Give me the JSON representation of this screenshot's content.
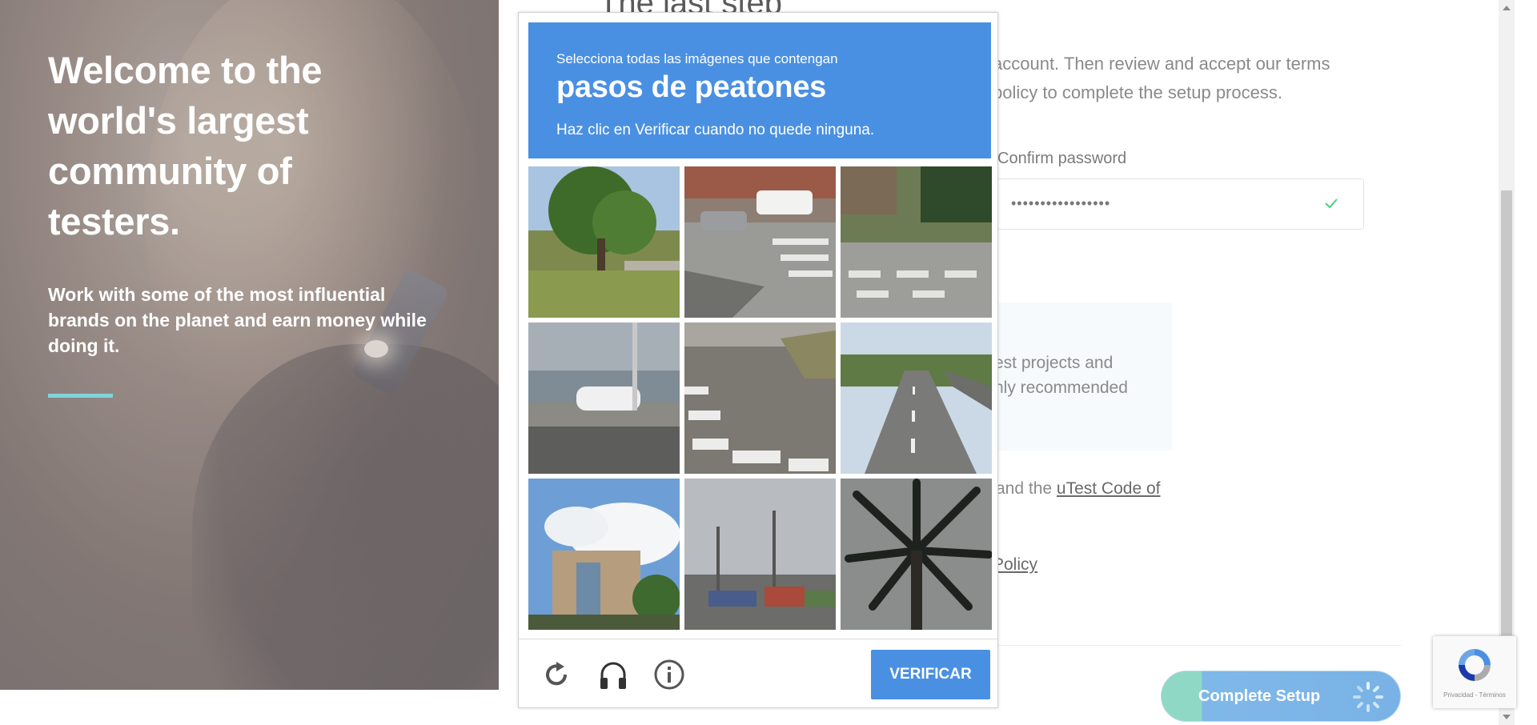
{
  "hero": {
    "title": "Welcome to the world's largest community of testers.",
    "subtitle": "Work with some of the most influential brands on the planet and earn money while doing it."
  },
  "form": {
    "heading": "The last step",
    "intro": "account. Then review and accept our terms policy to complete the setup process.",
    "confirm_password_label": "Confirm password",
    "confirm_password_value": "•••••••••••••••••",
    "info_line1": "est projects and",
    "info_line2": "hly recommended",
    "info_line3": ".",
    "terms_text": "and the ",
    "terms_link": "uTest Code of",
    "policy_link": "Policy",
    "complete_button": "Complete Setup"
  },
  "captcha": {
    "instruction_line1": "Selecciona todas las imágenes que contengan",
    "target_object": "pasos de peatones",
    "instruction_line3": "Haz clic en Verificar cuando no quede ninguna.",
    "verify_button": "VERIFICAR",
    "tiles": [
      "tree-park-image",
      "street-crosswalk-truck-image",
      "street-crosswalk-corner-image",
      "bridge-car-image",
      "crosswalk-closeup-image",
      "highway-image",
      "building-clouds-image",
      "street-poles-image",
      "palm-tree-image"
    ]
  },
  "recaptcha_badge": {
    "text": "Privacidad - Términos"
  },
  "colors": {
    "captcha_blue": "#4a90e2",
    "accent_teal": "#7fd3dc",
    "check_green": "#4cd07d"
  }
}
